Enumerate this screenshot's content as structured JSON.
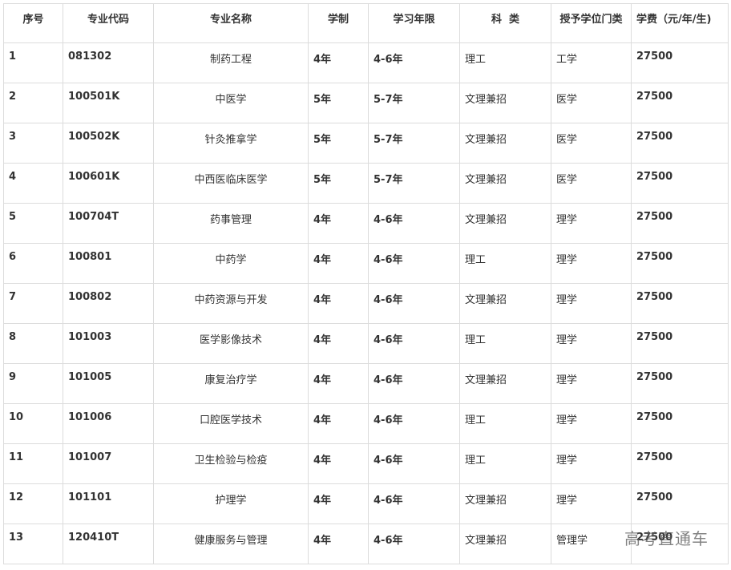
{
  "headers": [
    "序号",
    "专业代码",
    "专业名称",
    "学制",
    "学习年限",
    "科  类",
    "授予学位门类",
    "学费（元/年/生)"
  ],
  "rows": [
    [
      "1",
      "081302",
      "制药工程",
      "4年",
      "4-6年",
      "理工",
      "工学",
      "27500"
    ],
    [
      "2",
      "100501K",
      "中医学",
      "5年",
      "5-7年",
      "文理兼招",
      "医学",
      "27500"
    ],
    [
      "3",
      "100502K",
      "针灸推拿学",
      "5年",
      "5-7年",
      "文理兼招",
      "医学",
      "27500"
    ],
    [
      "4",
      "100601K",
      "中西医临床医学",
      "5年",
      "5-7年",
      "文理兼招",
      "医学",
      "27500"
    ],
    [
      "5",
      "100704T",
      "药事管理",
      "4年",
      "4-6年",
      "文理兼招",
      "理学",
      "27500"
    ],
    [
      "6",
      "100801",
      "中药学",
      "4年",
      "4-6年",
      "理工",
      "理学",
      "27500"
    ],
    [
      "7",
      "100802",
      "中药资源与开发",
      "4年",
      "4-6年",
      "文理兼招",
      "理学",
      "27500"
    ],
    [
      "8",
      "101003",
      "医学影像技术",
      "4年",
      "4-6年",
      "理工",
      "理学",
      "27500"
    ],
    [
      "9",
      "101005",
      "康复治疗学",
      "4年",
      "4-6年",
      "文理兼招",
      "理学",
      "27500"
    ],
    [
      "10",
      "101006",
      "口腔医学技术",
      "4年",
      "4-6年",
      "理工",
      "理学",
      "27500"
    ],
    [
      "11",
      "101007",
      "卫生检验与检疫",
      "4年",
      "4-6年",
      "理工",
      "理学",
      "27500"
    ],
    [
      "12",
      "101101",
      "护理学",
      "4年",
      "4-6年",
      "文理兼招",
      "理学",
      "27500"
    ],
    [
      "13",
      "120410T",
      "健康服务与管理",
      "4年",
      "4-6年",
      "文理兼招",
      "管理学",
      "27500"
    ]
  ],
  "watermark": "高考直通车"
}
